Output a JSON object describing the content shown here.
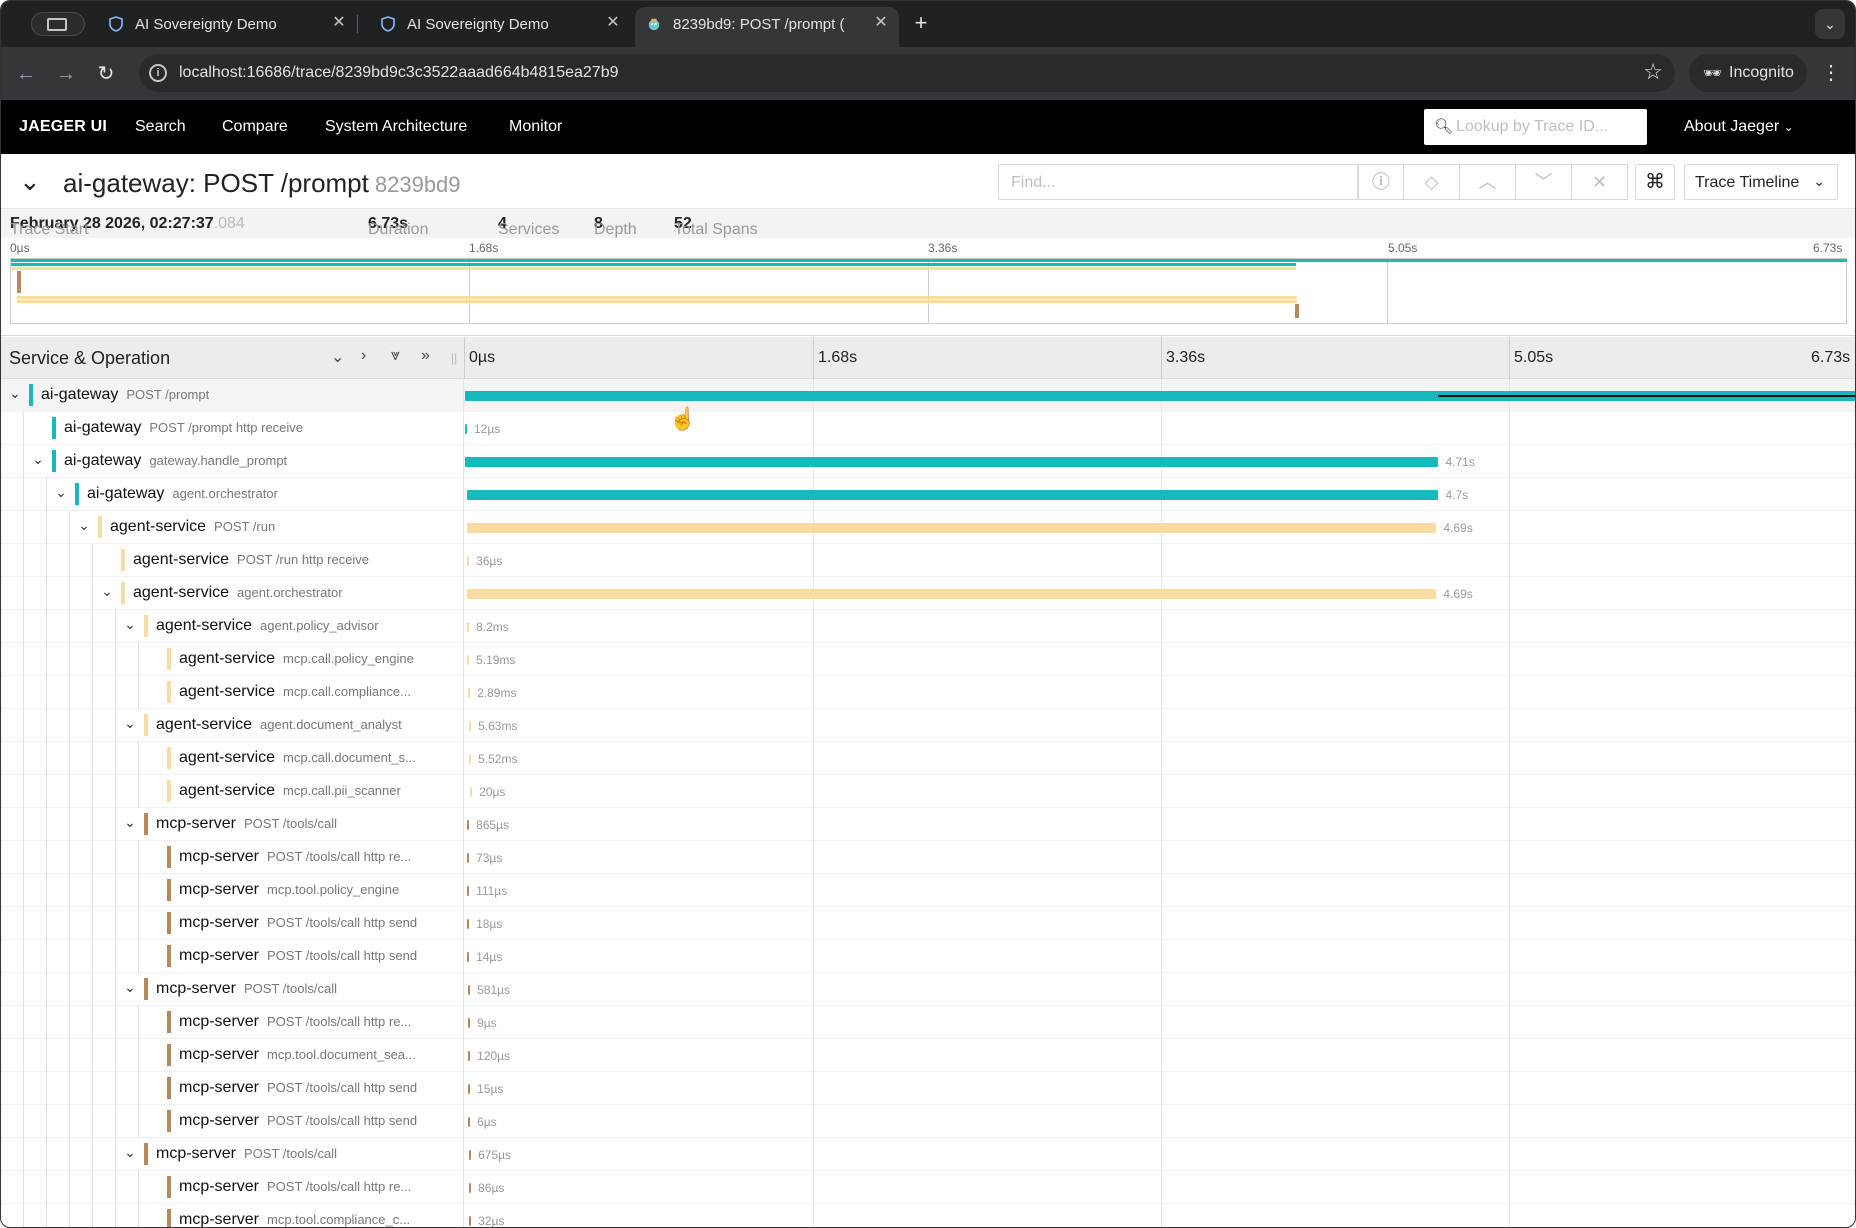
{
  "browser": {
    "tabs": [
      {
        "title": "AI Sovereignty Demo",
        "icon": "shield-icon",
        "active": false
      },
      {
        "title": "AI Sovereignty Demo",
        "icon": "shield-icon",
        "active": false
      },
      {
        "title": "8239bd9: POST /prompt (",
        "icon": "jaeger-gopher-icon",
        "active": true
      }
    ],
    "url": "localhost:16686/trace/8239bd9c3c3522aaad664b4815ea27b9",
    "incognito_label": "Incognito"
  },
  "jaeger_nav": {
    "brand": "JAEGER UI",
    "items": [
      "Search",
      "Compare",
      "System Architecture",
      "Monitor"
    ],
    "lookup_placeholder": "Lookup by Trace ID...",
    "about": "About Jaeger"
  },
  "trace": {
    "title": "ai-gateway: POST /prompt",
    "short_id": "8239bd9",
    "find_placeholder": "Find...",
    "view_selector": "Trace Timeline",
    "meta": {
      "trace_start_label": "Trace Start",
      "trace_start_value": "February 28 2026, 02:27:37",
      "trace_start_ms": ".084",
      "duration_label": "Duration",
      "duration_value": "6.73s",
      "services_label": "Services",
      "services_value": "4",
      "depth_label": "Depth",
      "depth_value": "8",
      "total_spans_label": "Total Spans",
      "total_spans_value": "52"
    },
    "minimap_ticks": [
      "0µs",
      "1.68s",
      "3.36s",
      "5.05s",
      "6.73s"
    ],
    "column_header": "Service & Operation",
    "timeline_ticks": [
      "0µs",
      "1.68s",
      "3.36s",
      "5.05s",
      "6.73s"
    ]
  },
  "colors": {
    "ai-gateway": "#17b8be",
    "agent-service": "#f8dcA1",
    "mcp-server": "#b7885e"
  },
  "spans": [
    {
      "depth": 0,
      "toggle": true,
      "service": "ai-gateway",
      "operation": "POST /prompt",
      "start": 0,
      "dur_s": 6.73,
      "label": ""
    },
    {
      "depth": 1,
      "toggle": false,
      "service": "ai-gateway",
      "operation": "POST /prompt http receive",
      "start": 0,
      "dur_s": 1.2e-05,
      "label": "12µs"
    },
    {
      "depth": 1,
      "toggle": true,
      "service": "ai-gateway",
      "operation": "gateway.handle_prompt",
      "start": 0,
      "dur_s": 4.71,
      "label": "4.71s"
    },
    {
      "depth": 2,
      "toggle": true,
      "service": "ai-gateway",
      "operation": "agent.orchestrator",
      "start": 0.01,
      "dur_s": 4.7,
      "label": "4.7s"
    },
    {
      "depth": 3,
      "toggle": true,
      "service": "agent-service",
      "operation": "POST /run",
      "start": 0.01,
      "dur_s": 4.69,
      "label": "4.69s"
    },
    {
      "depth": 4,
      "toggle": false,
      "service": "agent-service",
      "operation": "POST /run http receive",
      "start": 0.01,
      "dur_s": 3.6e-05,
      "label": "36µs"
    },
    {
      "depth": 4,
      "toggle": true,
      "service": "agent-service",
      "operation": "agent.orchestrator",
      "start": 0.01,
      "dur_s": 4.69,
      "label": "4.69s"
    },
    {
      "depth": 5,
      "toggle": true,
      "service": "agent-service",
      "operation": "agent.policy_advisor",
      "start": 0.01,
      "dur_s": 0.0082,
      "label": "8.2ms"
    },
    {
      "depth": 6,
      "toggle": false,
      "service": "agent-service",
      "operation": "mcp.call.policy_engine",
      "start": 0.01,
      "dur_s": 0.00519,
      "label": "5.19ms"
    },
    {
      "depth": 6,
      "toggle": false,
      "service": "agent-service",
      "operation": "mcp.call.compliance...",
      "start": 0.015,
      "dur_s": 0.00289,
      "label": "2.89ms"
    },
    {
      "depth": 5,
      "toggle": true,
      "service": "agent-service",
      "operation": "agent.document_analyst",
      "start": 0.02,
      "dur_s": 0.00563,
      "label": "5.63ms"
    },
    {
      "depth": 6,
      "toggle": false,
      "service": "agent-service",
      "operation": "mcp.call.document_s...",
      "start": 0.02,
      "dur_s": 0.00552,
      "label": "5.52ms"
    },
    {
      "depth": 6,
      "toggle": false,
      "service": "agent-service",
      "operation": "mcp.call.pii_scanner",
      "start": 0.025,
      "dur_s": 2e-05,
      "label": "20µs"
    },
    {
      "depth": 5,
      "toggle": true,
      "service": "mcp-server",
      "operation": "POST /tools/call",
      "start": 0.01,
      "dur_s": 0.000865,
      "label": "865µs"
    },
    {
      "depth": 6,
      "toggle": false,
      "service": "mcp-server",
      "operation": "POST /tools/call http re...",
      "start": 0.01,
      "dur_s": 7.3e-05,
      "label": "73µs"
    },
    {
      "depth": 6,
      "toggle": false,
      "service": "mcp-server",
      "operation": "mcp.tool.policy_engine",
      "start": 0.01,
      "dur_s": 0.000111,
      "label": "111µs"
    },
    {
      "depth": 6,
      "toggle": false,
      "service": "mcp-server",
      "operation": "POST /tools/call http send",
      "start": 0.01,
      "dur_s": 1.8e-05,
      "label": "18µs"
    },
    {
      "depth": 6,
      "toggle": false,
      "service": "mcp-server",
      "operation": "POST /tools/call http send",
      "start": 0.01,
      "dur_s": 1.4e-05,
      "label": "14µs"
    },
    {
      "depth": 5,
      "toggle": true,
      "service": "mcp-server",
      "operation": "POST /tools/call",
      "start": 0.015,
      "dur_s": 0.000581,
      "label": "581µs"
    },
    {
      "depth": 6,
      "toggle": false,
      "service": "mcp-server",
      "operation": "POST /tools/call http re...",
      "start": 0.015,
      "dur_s": 9e-06,
      "label": "9µs"
    },
    {
      "depth": 6,
      "toggle": false,
      "service": "mcp-server",
      "operation": "mcp.tool.document_sea...",
      "start": 0.015,
      "dur_s": 0.00012,
      "label": "120µs"
    },
    {
      "depth": 6,
      "toggle": false,
      "service": "mcp-server",
      "operation": "POST /tools/call http send",
      "start": 0.015,
      "dur_s": 1.5e-05,
      "label": "15µs"
    },
    {
      "depth": 6,
      "toggle": false,
      "service": "mcp-server",
      "operation": "POST /tools/call http send",
      "start": 0.015,
      "dur_s": 6e-06,
      "label": "6µs"
    },
    {
      "depth": 5,
      "toggle": true,
      "service": "mcp-server",
      "operation": "POST /tools/call",
      "start": 0.02,
      "dur_s": 0.000675,
      "label": "675µs"
    },
    {
      "depth": 6,
      "toggle": false,
      "service": "mcp-server",
      "operation": "POST /tools/call http re...",
      "start": 0.02,
      "dur_s": 8.6e-05,
      "label": "86µs"
    },
    {
      "depth": 6,
      "toggle": false,
      "service": "mcp-server",
      "operation": "mcp.tool.compliance_c...",
      "start": 0.02,
      "dur_s": 3.2e-05,
      "label": "32µs"
    }
  ]
}
